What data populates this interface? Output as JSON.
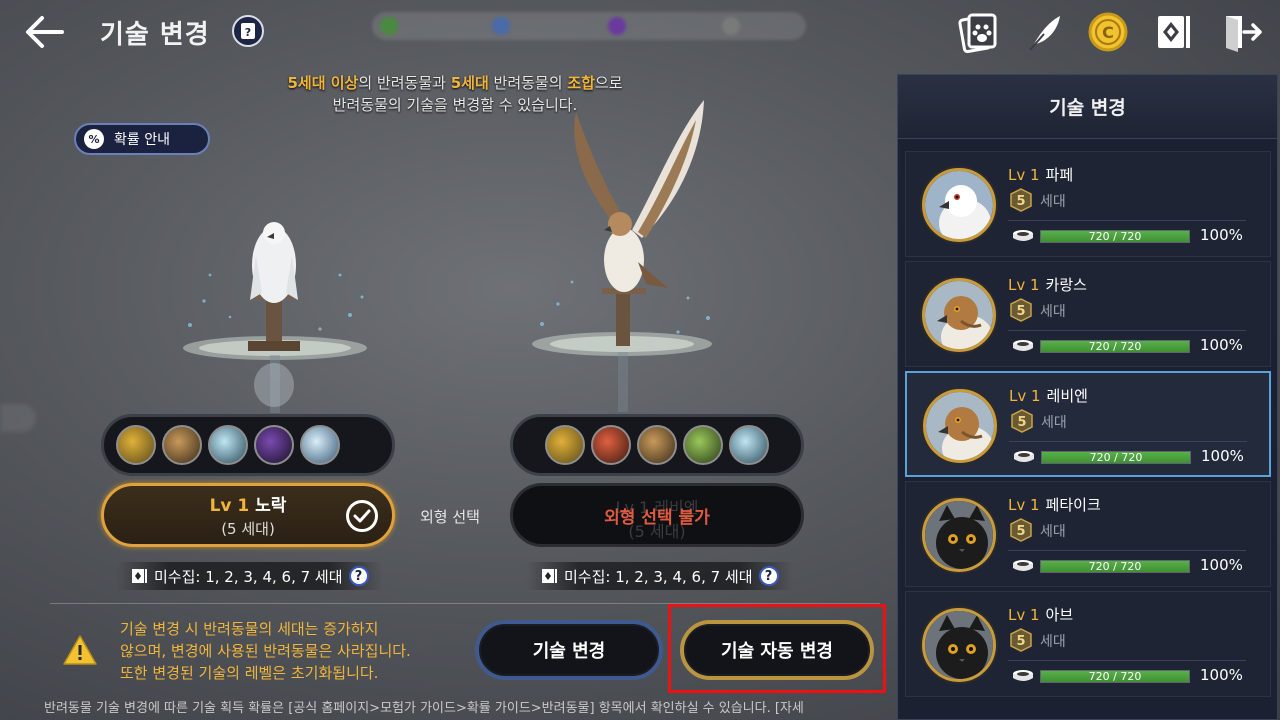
{
  "header": {
    "title": "기술 변경"
  },
  "instruction": {
    "hl1": "5세대 이상",
    "t1": "의 반려동물과 ",
    "hl2": "5세대",
    "t2": " 반려동물의 ",
    "hl3": "조합",
    "t3": "으로",
    "line2": "반려동물의 기술을 변경할 수 있습니다."
  },
  "rate_button": {
    "icon": "%",
    "label": "확률 안내"
  },
  "left_pet": {
    "lv": "Lv 1",
    "name": "노락",
    "generation": "(5 세대)",
    "uncollected": "미수집: 1, 2, 3, 4, 6, 7 세대"
  },
  "look_select_label": "외형 선택",
  "right_pet": {
    "ghost_line1": "Lv 1 레비엔",
    "ghost_line2": "(5 세대)",
    "unavailable": "외형 선택 불가",
    "uncollected": "미수집: 1, 2, 3, 4, 6, 7 세대"
  },
  "warning": {
    "line1": "기술 변경 시 반려동물의 세대는 증가하지",
    "line2": "않으며, 변경에 사용된 반려동물은 사라집니다.",
    "line3": "또한 변경된 기술의 레벨은 초기화됩니다."
  },
  "buttons": {
    "change": "기술 변경",
    "auto_change": "기술 자동 변경"
  },
  "footer_note": "반려동물 기술 변경에 따른 기술 획득 확률은 [공식 홈페이지>모험가 가이드>확률 가이드>반려동물] 항목에서 확인하실 수 있습니다. [자세",
  "panel": {
    "title": "기술 변경",
    "pets": [
      {
        "lv": "Lv 1",
        "name": "파페",
        "generation": "5",
        "gen_label": "세대",
        "bond": "720 / 720",
        "bond_fraction": 1.0,
        "pct": "100%",
        "kind": "white-hawk",
        "selected": false
      },
      {
        "lv": "Lv 1",
        "name": "카랑스",
        "generation": "5",
        "gen_label": "세대",
        "bond": "720 / 720",
        "bond_fraction": 1.0,
        "pct": "100%",
        "kind": "brown-hawk",
        "selected": false
      },
      {
        "lv": "Lv 1",
        "name": "레비엔",
        "generation": "5",
        "gen_label": "세대",
        "bond": "720 / 720",
        "bond_fraction": 1.0,
        "pct": "100%",
        "kind": "brown-hawk",
        "selected": true
      },
      {
        "lv": "Lv 1",
        "name": "페타이크",
        "generation": "5",
        "gen_label": "세대",
        "bond": "720 / 720",
        "bond_fraction": 1.0,
        "pct": "100%",
        "kind": "black-cat",
        "selected": false
      },
      {
        "lv": "Lv 1",
        "name": "아브",
        "generation": "5",
        "gen_label": "세대",
        "bond": "720 / 720",
        "bond_fraction": 1.0,
        "pct": "100%",
        "kind": "black-cat",
        "selected": false
      }
    ]
  },
  "skills_left": [
    "skill-multi",
    "skill-pick",
    "skill-ice",
    "skill-dark",
    "skill-gather"
  ],
  "skills_right": [
    "skill-multi",
    "skill-hunt",
    "skill-pick",
    "skill-nature",
    "skill-ice"
  ],
  "colors": {
    "accent": "#f0b53a",
    "bond_bar": "#58b04a",
    "selected_border": "#5aa3d8",
    "highlight": "#ee1111"
  }
}
